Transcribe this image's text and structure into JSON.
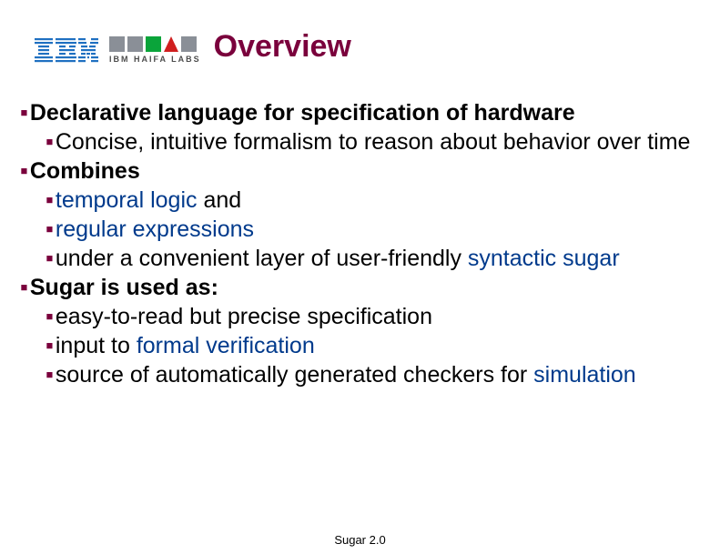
{
  "logo": {
    "haifa_text": "IBM HAIFA LABS"
  },
  "title": "Overview",
  "bullets": {
    "b1": "Declarative language for specification of hardware",
    "b1a": "Concise, intuitive formalism to reason about behavior over time",
    "b2": "Combines",
    "b2a_pre": "",
    "b2a_term": "temporal logic",
    "b2a_post": " and",
    "b2b_term": "regular expressions",
    "b2c_pre": "under a convenient layer of user-friendly ",
    "b2c_term": "syntactic sugar",
    "b3": "Sugar is used as:",
    "b3a": "easy-to-read but precise specification",
    "b3b_pre": "input to ",
    "b3b_term": "formal verification",
    "b3c_pre": "source of automatically generated checkers for ",
    "b3c_term": "simulation"
  },
  "footer": "Sugar 2.0"
}
